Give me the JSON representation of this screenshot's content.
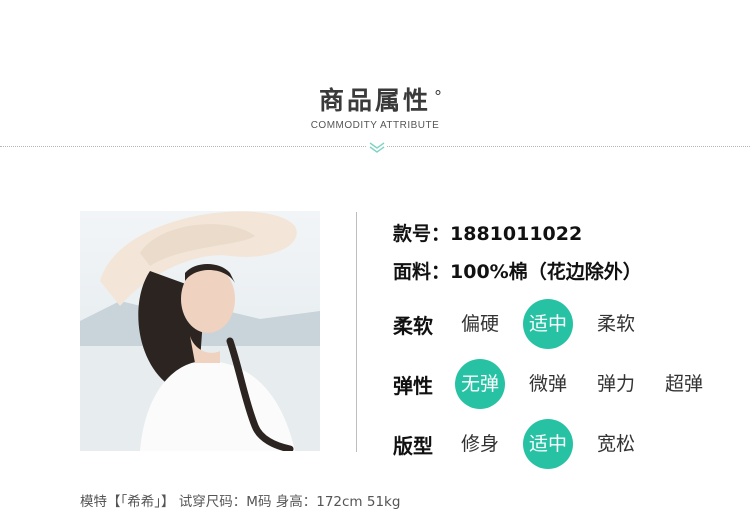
{
  "header": {
    "title": "商品属性",
    "title_mark": "°",
    "subtitle": "COMMODITY ATTRIBUTE"
  },
  "specs": {
    "style_no_label": "款号：",
    "style_no_value": "1881011022",
    "fabric_label": "面料：",
    "fabric_value": "100%棉（花边除外）"
  },
  "attributes": [
    {
      "label": "柔软",
      "options": [
        "偏硬",
        "适中",
        "柔软"
      ],
      "selected": 1
    },
    {
      "label": "弹性",
      "options": [
        "无弹",
        "微弹",
        "弹力",
        "超弹"
      ],
      "selected": 0
    },
    {
      "label": "版型",
      "options": [
        "修身",
        "适中",
        "宽松"
      ],
      "selected": 1
    }
  ],
  "caption": "模特【「希希」】 试穿尺码：M码 身高：172cm 51kg",
  "colors": {
    "accent": "#27c2a4",
    "chevron": "#7fd3c4"
  },
  "icons": {
    "chevron": "double-chevron-down-icon"
  }
}
